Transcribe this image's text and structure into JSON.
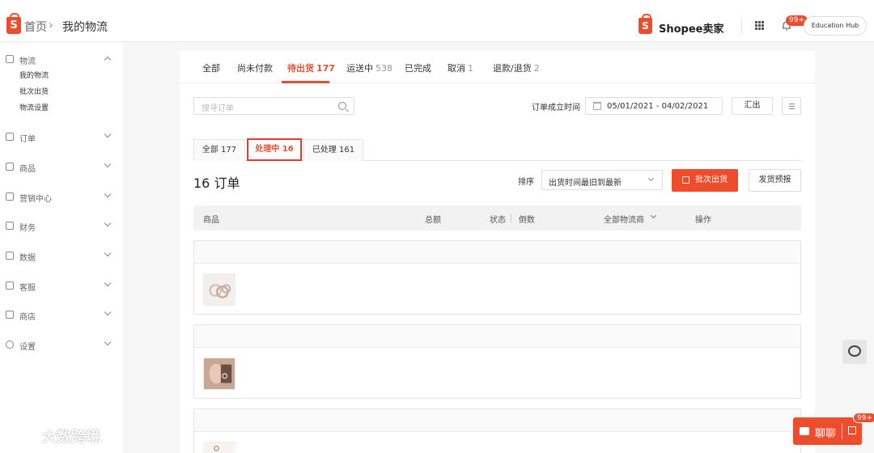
{
  "header": {
    "breadcrumb_home": "首页",
    "breadcrumb_sep": "›",
    "breadcrumb_current": "我的物流",
    "logo_letter": "S",
    "brand": "Shopee卖家",
    "notif_badge": "99+",
    "edu_hub": "Education Hub"
  },
  "sidebar": {
    "groups": [
      {
        "label": "物流",
        "icon": "logistics-icon",
        "expanded": true,
        "items": [
          "我的物流",
          "批次出货",
          "物流设置"
        ]
      },
      {
        "label": "订单",
        "icon": "order-icon"
      },
      {
        "label": "商品",
        "icon": "product-icon"
      },
      {
        "label": "营销中心",
        "icon": "marketing-icon"
      },
      {
        "label": "财务",
        "icon": "finance-icon"
      },
      {
        "label": "数据",
        "icon": "data-icon"
      },
      {
        "label": "客服",
        "icon": "customer-service-icon"
      },
      {
        "label": "商店",
        "icon": "shop-icon"
      },
      {
        "label": "设置",
        "icon": "settings-icon"
      }
    ]
  },
  "tabs": [
    {
      "label": "全部",
      "count": ""
    },
    {
      "label": "尚未付款",
      "count": ""
    },
    {
      "label": "待出货",
      "count": "177"
    },
    {
      "label": "运送中",
      "count": "538"
    },
    {
      "label": "已完成",
      "count": ""
    },
    {
      "label": "取消",
      "count": "1"
    },
    {
      "label": "退款/退货",
      "count": "2"
    }
  ],
  "search": {
    "placeholder": "搜寻订单"
  },
  "date_filter": {
    "label": "订单成立时间",
    "value": "05/01/2021 - 04/02/2021"
  },
  "export_label": "汇出",
  "subtabs": [
    {
      "label": "全部 177"
    },
    {
      "label": "处理中 16"
    },
    {
      "label": "已处理 161"
    }
  ],
  "orders_count": "16 订单",
  "sort": {
    "label": "排序",
    "value": "出货时间最旧到最新"
  },
  "batch_ship_label": "批次出货",
  "forecast_label": "发货预报",
  "table_headers": {
    "product": "商品",
    "total": "总额",
    "status": "状态",
    "countdown": "倒数",
    "carrier": "全部物流商",
    "action": "操作"
  },
  "chat": {
    "label": "聊聊",
    "badge": "99+"
  },
  "watermark": "大数跨境",
  "colors": {
    "accent": "#ee4d2d",
    "active_outline": "#e5392b"
  }
}
